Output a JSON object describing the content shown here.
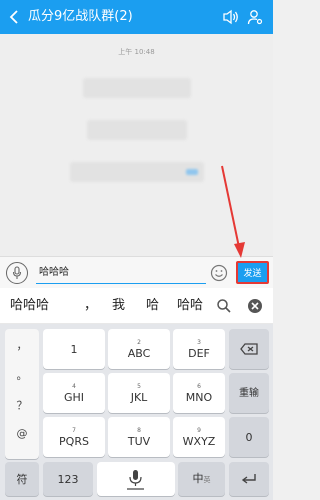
{
  "header": {
    "title": "瓜分9亿战队群(2)",
    "bg_color": "#1b9ef0"
  },
  "chat": {
    "timestamp": "上午 10:48",
    "system_messages": [
      "",
      ""
    ]
  },
  "input": {
    "value": "哈哈哈",
    "send_label": "发送"
  },
  "candidates": [
    "哈哈哈",
    "，",
    "我",
    "哈",
    "哈哈"
  ],
  "keyboard": {
    "punctuation": [
      "，",
      "。",
      "？",
      "@"
    ],
    "rows": [
      [
        {
          "num": "",
          "label": "1"
        },
        {
          "num": "",
          "label": "ABC"
        },
        {
          "num": "",
          "label": "DEF"
        }
      ],
      [
        {
          "num": "",
          "label": "GHI"
        },
        {
          "num": "",
          "label": "JKL"
        },
        {
          "num": "",
          "label": "MNO"
        }
      ],
      [
        {
          "num": "",
          "label": "PQRS"
        },
        {
          "num": "",
          "label": "TUV"
        },
        {
          "num": "",
          "label": "WXYZ"
        }
      ]
    ],
    "row_nums": [
      [
        "",
        "2",
        "3"
      ],
      [
        "4",
        "5",
        "6"
      ],
      [
        "7",
        "8",
        "9"
      ]
    ],
    "retype_label": "重输",
    "zero_label": "0",
    "symbol_label": "符",
    "numeric_label": "123",
    "lang_label": "中",
    "lang_sub": "英"
  }
}
